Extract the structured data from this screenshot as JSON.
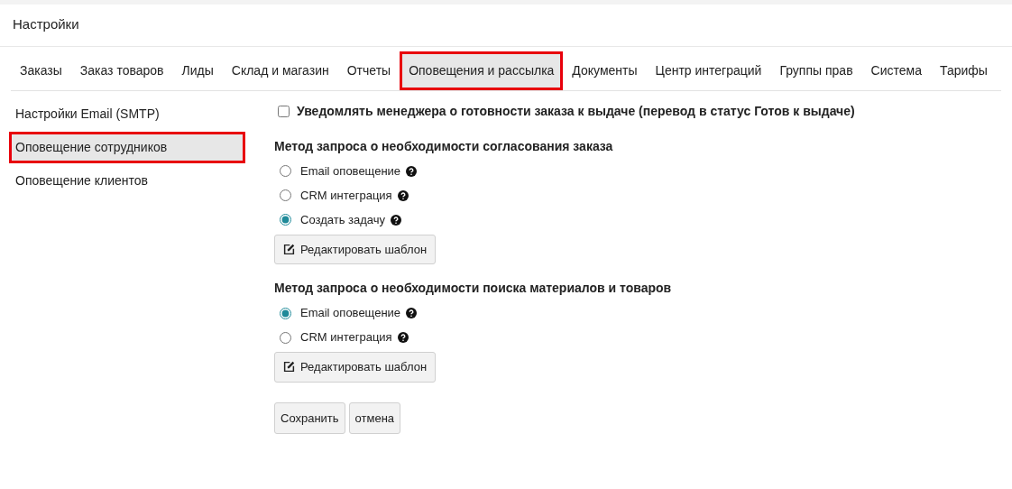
{
  "header": {
    "title": "Настройки"
  },
  "tabs": [
    {
      "label": "Заказы",
      "selected": false,
      "highlighted": false
    },
    {
      "label": "Заказ товаров",
      "selected": false,
      "highlighted": false
    },
    {
      "label": "Лиды",
      "selected": false,
      "highlighted": false
    },
    {
      "label": "Склад и магазин",
      "selected": false,
      "highlighted": false
    },
    {
      "label": "Отчеты",
      "selected": false,
      "highlighted": false
    },
    {
      "label": "Оповещения и рассылка",
      "selected": true,
      "highlighted": true
    },
    {
      "label": "Документы",
      "selected": false,
      "highlighted": false
    },
    {
      "label": "Центр интеграций",
      "selected": false,
      "highlighted": false
    },
    {
      "label": "Группы прав",
      "selected": false,
      "highlighted": false
    },
    {
      "label": "Система",
      "selected": false,
      "highlighted": false
    },
    {
      "label": "Тарифы",
      "selected": false,
      "highlighted": false
    }
  ],
  "sidebar": {
    "items": [
      {
        "label": "Настройки Email (SMTP)",
        "selected": false,
        "highlighted": false
      },
      {
        "label": "Оповещение сотрудников",
        "selected": true,
        "highlighted": true
      },
      {
        "label": "Оповещение клиентов",
        "selected": false,
        "highlighted": false
      }
    ]
  },
  "notify_checkbox": {
    "label": "Уведомлять менеджера о готовности заказа к выдаче (перевод в статус Готов к выдаче)",
    "checked": false
  },
  "groups": [
    {
      "title": "Метод запроса о необходимости согласования заказа",
      "options": [
        {
          "label": "Email оповещение",
          "selected": false
        },
        {
          "label": "CRM интеграция",
          "selected": false
        },
        {
          "label": "Создать задачу",
          "selected": true
        }
      ],
      "button": "Редактировать шаблон"
    },
    {
      "title": "Метод запроса о необходимости поиска материалов и товаров",
      "options": [
        {
          "label": "Email оповещение",
          "selected": true
        },
        {
          "label": "CRM интеграция",
          "selected": false
        }
      ],
      "button": "Редактировать шаблон"
    }
  ],
  "buttons": [
    "Сохранить",
    "отмена"
  ]
}
